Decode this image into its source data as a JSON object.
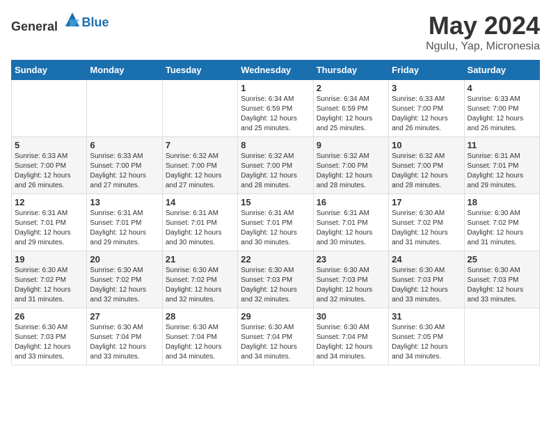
{
  "header": {
    "logo_general": "General",
    "logo_blue": "Blue",
    "month": "May 2024",
    "location": "Ngulu, Yap, Micronesia"
  },
  "weekdays": [
    "Sunday",
    "Monday",
    "Tuesday",
    "Wednesday",
    "Thursday",
    "Friday",
    "Saturday"
  ],
  "weeks": [
    [
      {
        "day": "",
        "info": ""
      },
      {
        "day": "",
        "info": ""
      },
      {
        "day": "",
        "info": ""
      },
      {
        "day": "1",
        "info": "Sunrise: 6:34 AM\nSunset: 6:59 PM\nDaylight: 12 hours\nand 25 minutes."
      },
      {
        "day": "2",
        "info": "Sunrise: 6:34 AM\nSunset: 6:59 PM\nDaylight: 12 hours\nand 25 minutes."
      },
      {
        "day": "3",
        "info": "Sunrise: 6:33 AM\nSunset: 7:00 PM\nDaylight: 12 hours\nand 26 minutes."
      },
      {
        "day": "4",
        "info": "Sunrise: 6:33 AM\nSunset: 7:00 PM\nDaylight: 12 hours\nand 26 minutes."
      }
    ],
    [
      {
        "day": "5",
        "info": "Sunrise: 6:33 AM\nSunset: 7:00 PM\nDaylight: 12 hours\nand 26 minutes."
      },
      {
        "day": "6",
        "info": "Sunrise: 6:33 AM\nSunset: 7:00 PM\nDaylight: 12 hours\nand 27 minutes."
      },
      {
        "day": "7",
        "info": "Sunrise: 6:32 AM\nSunset: 7:00 PM\nDaylight: 12 hours\nand 27 minutes."
      },
      {
        "day": "8",
        "info": "Sunrise: 6:32 AM\nSunset: 7:00 PM\nDaylight: 12 hours\nand 28 minutes."
      },
      {
        "day": "9",
        "info": "Sunrise: 6:32 AM\nSunset: 7:00 PM\nDaylight: 12 hours\nand 28 minutes."
      },
      {
        "day": "10",
        "info": "Sunrise: 6:32 AM\nSunset: 7:00 PM\nDaylight: 12 hours\nand 28 minutes."
      },
      {
        "day": "11",
        "info": "Sunrise: 6:31 AM\nSunset: 7:01 PM\nDaylight: 12 hours\nand 29 minutes."
      }
    ],
    [
      {
        "day": "12",
        "info": "Sunrise: 6:31 AM\nSunset: 7:01 PM\nDaylight: 12 hours\nand 29 minutes."
      },
      {
        "day": "13",
        "info": "Sunrise: 6:31 AM\nSunset: 7:01 PM\nDaylight: 12 hours\nand 29 minutes."
      },
      {
        "day": "14",
        "info": "Sunrise: 6:31 AM\nSunset: 7:01 PM\nDaylight: 12 hours\nand 30 minutes."
      },
      {
        "day": "15",
        "info": "Sunrise: 6:31 AM\nSunset: 7:01 PM\nDaylight: 12 hours\nand 30 minutes."
      },
      {
        "day": "16",
        "info": "Sunrise: 6:31 AM\nSunset: 7:01 PM\nDaylight: 12 hours\nand 30 minutes."
      },
      {
        "day": "17",
        "info": "Sunrise: 6:30 AM\nSunset: 7:02 PM\nDaylight: 12 hours\nand 31 minutes."
      },
      {
        "day": "18",
        "info": "Sunrise: 6:30 AM\nSunset: 7:02 PM\nDaylight: 12 hours\nand 31 minutes."
      }
    ],
    [
      {
        "day": "19",
        "info": "Sunrise: 6:30 AM\nSunset: 7:02 PM\nDaylight: 12 hours\nand 31 minutes."
      },
      {
        "day": "20",
        "info": "Sunrise: 6:30 AM\nSunset: 7:02 PM\nDaylight: 12 hours\nand 32 minutes."
      },
      {
        "day": "21",
        "info": "Sunrise: 6:30 AM\nSunset: 7:02 PM\nDaylight: 12 hours\nand 32 minutes."
      },
      {
        "day": "22",
        "info": "Sunrise: 6:30 AM\nSunset: 7:03 PM\nDaylight: 12 hours\nand 32 minutes."
      },
      {
        "day": "23",
        "info": "Sunrise: 6:30 AM\nSunset: 7:03 PM\nDaylight: 12 hours\nand 32 minutes."
      },
      {
        "day": "24",
        "info": "Sunrise: 6:30 AM\nSunset: 7:03 PM\nDaylight: 12 hours\nand 33 minutes."
      },
      {
        "day": "25",
        "info": "Sunrise: 6:30 AM\nSunset: 7:03 PM\nDaylight: 12 hours\nand 33 minutes."
      }
    ],
    [
      {
        "day": "26",
        "info": "Sunrise: 6:30 AM\nSunset: 7:03 PM\nDaylight: 12 hours\nand 33 minutes."
      },
      {
        "day": "27",
        "info": "Sunrise: 6:30 AM\nSunset: 7:04 PM\nDaylight: 12 hours\nand 33 minutes."
      },
      {
        "day": "28",
        "info": "Sunrise: 6:30 AM\nSunset: 7:04 PM\nDaylight: 12 hours\nand 34 minutes."
      },
      {
        "day": "29",
        "info": "Sunrise: 6:30 AM\nSunset: 7:04 PM\nDaylight: 12 hours\nand 34 minutes."
      },
      {
        "day": "30",
        "info": "Sunrise: 6:30 AM\nSunset: 7:04 PM\nDaylight: 12 hours\nand 34 minutes."
      },
      {
        "day": "31",
        "info": "Sunrise: 6:30 AM\nSunset: 7:05 PM\nDaylight: 12 hours\nand 34 minutes."
      },
      {
        "day": "",
        "info": ""
      }
    ]
  ]
}
